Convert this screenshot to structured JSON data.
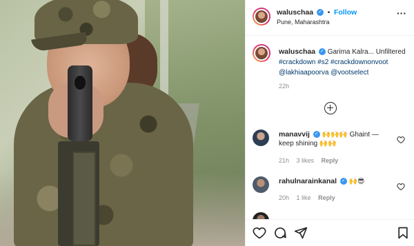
{
  "header": {
    "username": "waluschaa",
    "separator": "•",
    "follow_label": "Follow",
    "location": "Pune, Maharashtra",
    "more_icon": "more-horizontal-icon"
  },
  "caption": {
    "username": "waluschaa",
    "text": "Garima Kalra... Unfiltered",
    "hashtags": "#crackdown #s2 #crackdownonvoot",
    "mentions": "@lakhiaapoorva @vootselect",
    "time": "22h"
  },
  "load_more_icon": "plus-circle-icon",
  "comments": [
    {
      "username": "manavvij",
      "text": "🙌🙌🙌 Ghaint — keep shining 🙌🙌",
      "time": "21h",
      "likes": "3 likes",
      "reply": "Reply"
    },
    {
      "username": "rahulnarainkanal",
      "text": "🙌😎",
      "time": "20h",
      "likes": "1 like",
      "reply": "Reply"
    }
  ],
  "actions": [
    "heart-icon",
    "comment-icon",
    "share-icon",
    "bookmark-icon"
  ],
  "colors": {
    "accent": "#0095f6",
    "verified": "#3897f0",
    "muted": "#8e8e8e",
    "tag": "#00376b"
  }
}
